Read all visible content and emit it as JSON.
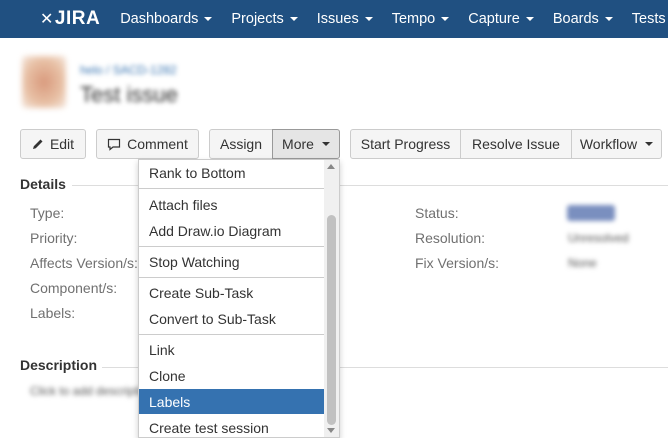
{
  "nav": {
    "logo": "JIRA",
    "items": [
      {
        "label": "Dashboards"
      },
      {
        "label": "Projects"
      },
      {
        "label": "Issues"
      },
      {
        "label": "Tempo"
      },
      {
        "label": "Capture"
      },
      {
        "label": "Boards"
      },
      {
        "label": "Tests"
      }
    ]
  },
  "issue": {
    "breadcrumb": "helo / SACD-1282",
    "title": "Test issue"
  },
  "toolbar": {
    "edit": "Edit",
    "comment": "Comment",
    "assign": "Assign",
    "more": "More",
    "start_progress": "Start Progress",
    "resolve_issue": "Resolve Issue",
    "workflow": "Workflow"
  },
  "details": {
    "title": "Details",
    "fields_left": [
      "Type:",
      "Priority:",
      "Affects Version/s:",
      "Component/s:",
      "Labels:"
    ],
    "fields_right": [
      "Status:",
      "Resolution:",
      "Fix Version/s:"
    ],
    "values_right": [
      "OPEN",
      "Unresolved",
      "None"
    ]
  },
  "description": {
    "title": "Description",
    "placeholder": "Click to add description"
  },
  "more_menu": {
    "items": [
      {
        "label": "Rank to Bottom"
      },
      {
        "label": "Attach files"
      },
      {
        "label": "Add Draw.io Diagram"
      },
      {
        "label": "Stop Watching"
      },
      {
        "label": "Create Sub-Task"
      },
      {
        "label": "Convert to Sub-Task"
      },
      {
        "label": "Link"
      },
      {
        "label": "Clone"
      },
      {
        "label": "Labels"
      },
      {
        "label": "Create test session"
      }
    ],
    "active": "Labels"
  },
  "colors": {
    "nav_bg": "#205081",
    "link": "#3572b0",
    "menu_active": "#3572b0"
  }
}
